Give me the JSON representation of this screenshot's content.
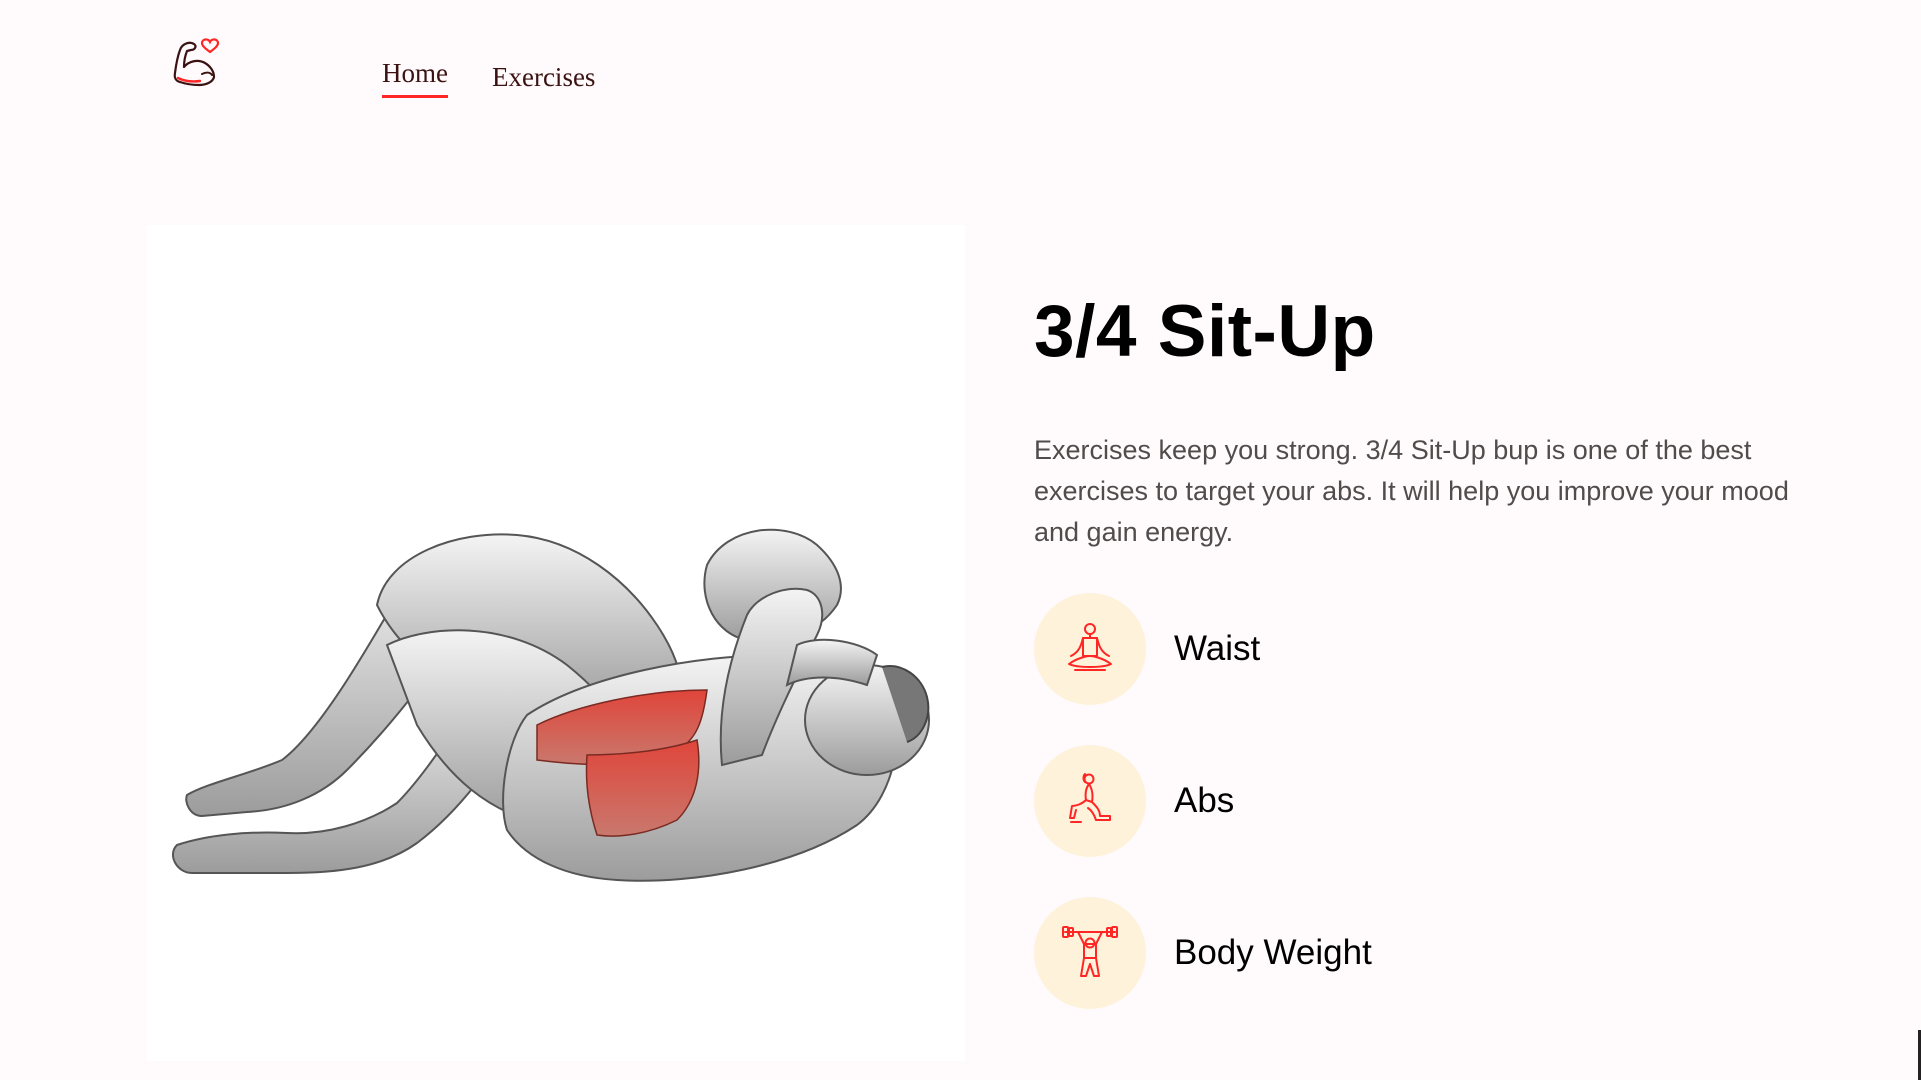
{
  "nav": {
    "logo_icon": "flexed-bicep-heart-icon",
    "links": [
      {
        "label": "Home",
        "active": true
      },
      {
        "label": "Exercises",
        "active": false
      }
    ],
    "accent_color": "#ff2625"
  },
  "exercise": {
    "image_icon": "sit-up-anatomy-illustration",
    "name": "3/4 Sit-Up",
    "description": "Exercises keep you strong. 3/4 Sit-Up bup is one of the best exercises to target your abs. It will help you improve your mood and gain energy.",
    "extras": [
      {
        "label": "Waist",
        "icon": "meditation-pose-icon"
      },
      {
        "label": "Abs",
        "icon": "lunge-pose-icon"
      },
      {
        "label": "Body Weight",
        "icon": "weightlifter-icon"
      }
    ]
  }
}
